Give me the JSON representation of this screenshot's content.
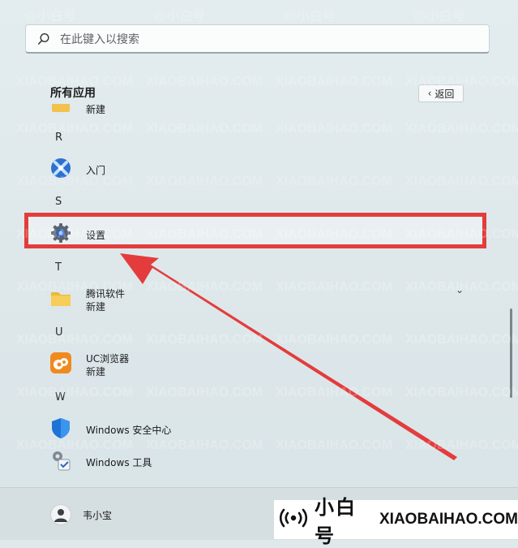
{
  "search": {
    "placeholder": "在此键入以搜索"
  },
  "all_apps": {
    "title": "所有应用",
    "back_label": "返回"
  },
  "list": {
    "partial_top": {
      "name": "新建",
      "icon": "folder-icon"
    },
    "letters": [
      "R",
      "S",
      "T",
      "U",
      "W"
    ],
    "items": [
      {
        "name": "入门",
        "icon": "get-started-icon"
      },
      {
        "name": "设置",
        "icon": "gear-icon"
      },
      {
        "name": "腾讯软件",
        "sub": "新建",
        "icon": "folder-icon"
      },
      {
        "name": "UC浏览器",
        "sub": "新建",
        "icon": "uc-browser-icon"
      },
      {
        "name": "Windows 安全中心",
        "icon": "shield-icon"
      },
      {
        "name": "Windows 工具",
        "icon": "tools-icon"
      }
    ]
  },
  "user": {
    "name": "韦小宝"
  },
  "watermark": {
    "text_cn": "@小白号",
    "text_en": "XIAOBAIHAO.COM"
  },
  "brand": {
    "text_cn": "小白号",
    "text_en": "XIAOBAIHAO.COM"
  },
  "colors": {
    "highlight": "#e43c3c",
    "accent": "#3b77d8"
  }
}
